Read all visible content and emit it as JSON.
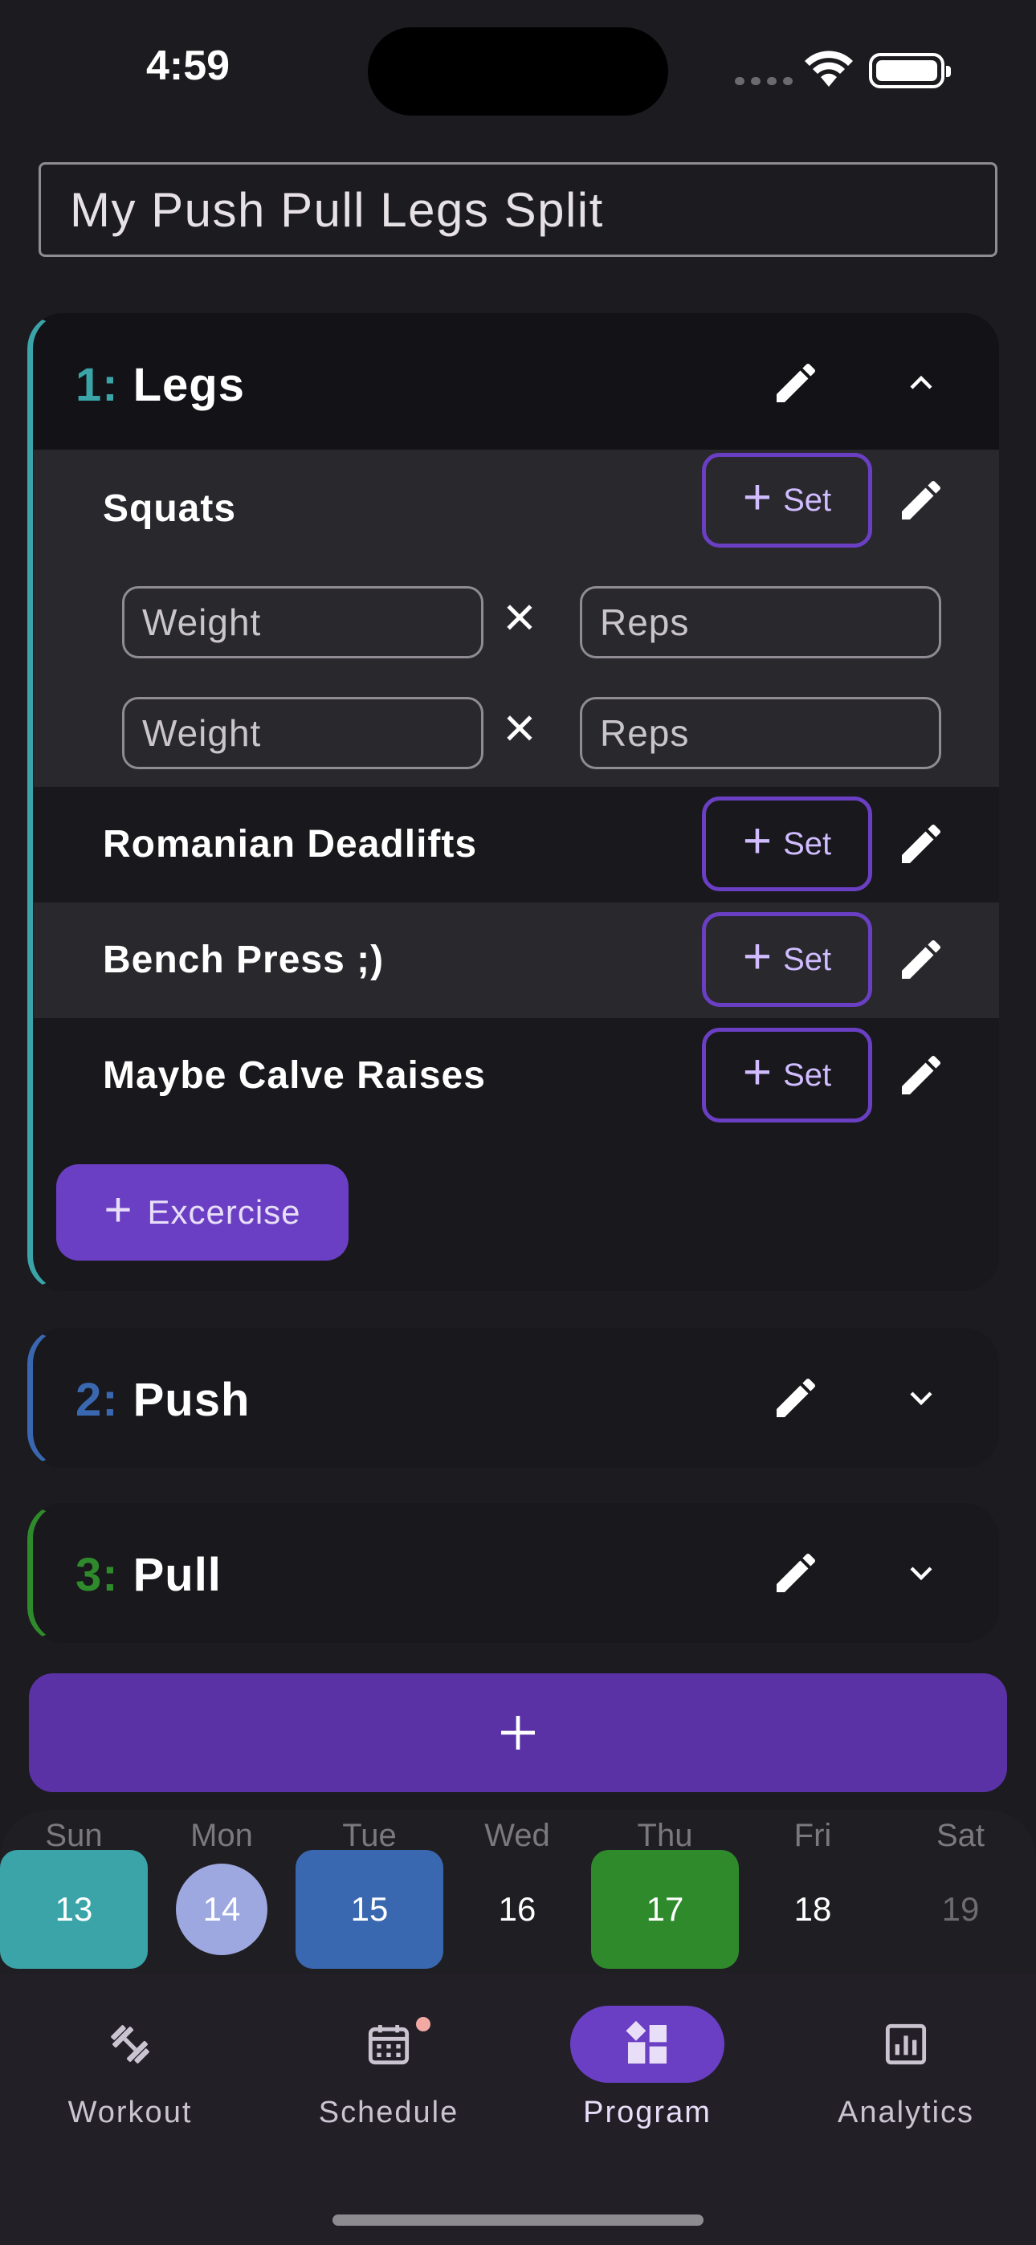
{
  "status_bar": {
    "time": "4:59"
  },
  "program": {
    "name": "My Push Pull Legs Split"
  },
  "days": [
    {
      "number": "1:",
      "name": "Legs",
      "accent": "#3aa4a9",
      "expanded": true,
      "exercises": [
        {
          "name": "Squats",
          "sets": [
            {
              "weight_placeholder": "Weight",
              "reps_placeholder": "Reps"
            },
            {
              "weight_placeholder": "Weight",
              "reps_placeholder": "Reps"
            }
          ]
        },
        {
          "name": "Romanian Deadlifts"
        },
        {
          "name": "Bench Press ;)"
        },
        {
          "name": "Maybe Calve Raises"
        }
      ],
      "set_button_label": "Set",
      "add_exercise_label": "Excercise"
    },
    {
      "number": "2:",
      "name": "Push",
      "accent": "#3a68b0",
      "expanded": false
    },
    {
      "number": "3:",
      "name": "Pull",
      "accent": "#2f8a2c",
      "expanded": false
    }
  ],
  "week": [
    {
      "label": "Sun",
      "date": "13",
      "color": "#3aa4a9"
    },
    {
      "label": "Mon",
      "date": "14",
      "color": "#9ea8e0",
      "today": true
    },
    {
      "label": "Tue",
      "date": "15",
      "color": "#3a68b0"
    },
    {
      "label": "Wed",
      "date": "16"
    },
    {
      "label": "Thu",
      "date": "17",
      "color": "#2f8a2c"
    },
    {
      "label": "Fri",
      "date": "18"
    },
    {
      "label": "Sat",
      "date": "19"
    }
  ],
  "nav": [
    {
      "label": "Workout",
      "icon": "dumbbell-icon"
    },
    {
      "label": "Schedule",
      "icon": "calendar-icon",
      "badge": true
    },
    {
      "label": "Program",
      "icon": "dashboard-icon",
      "active": true
    },
    {
      "label": "Analytics",
      "icon": "bar-chart-icon"
    }
  ],
  "colors": {
    "primary": "#6a3fc4",
    "background": "#1c1b1f",
    "card": "#19181c"
  }
}
